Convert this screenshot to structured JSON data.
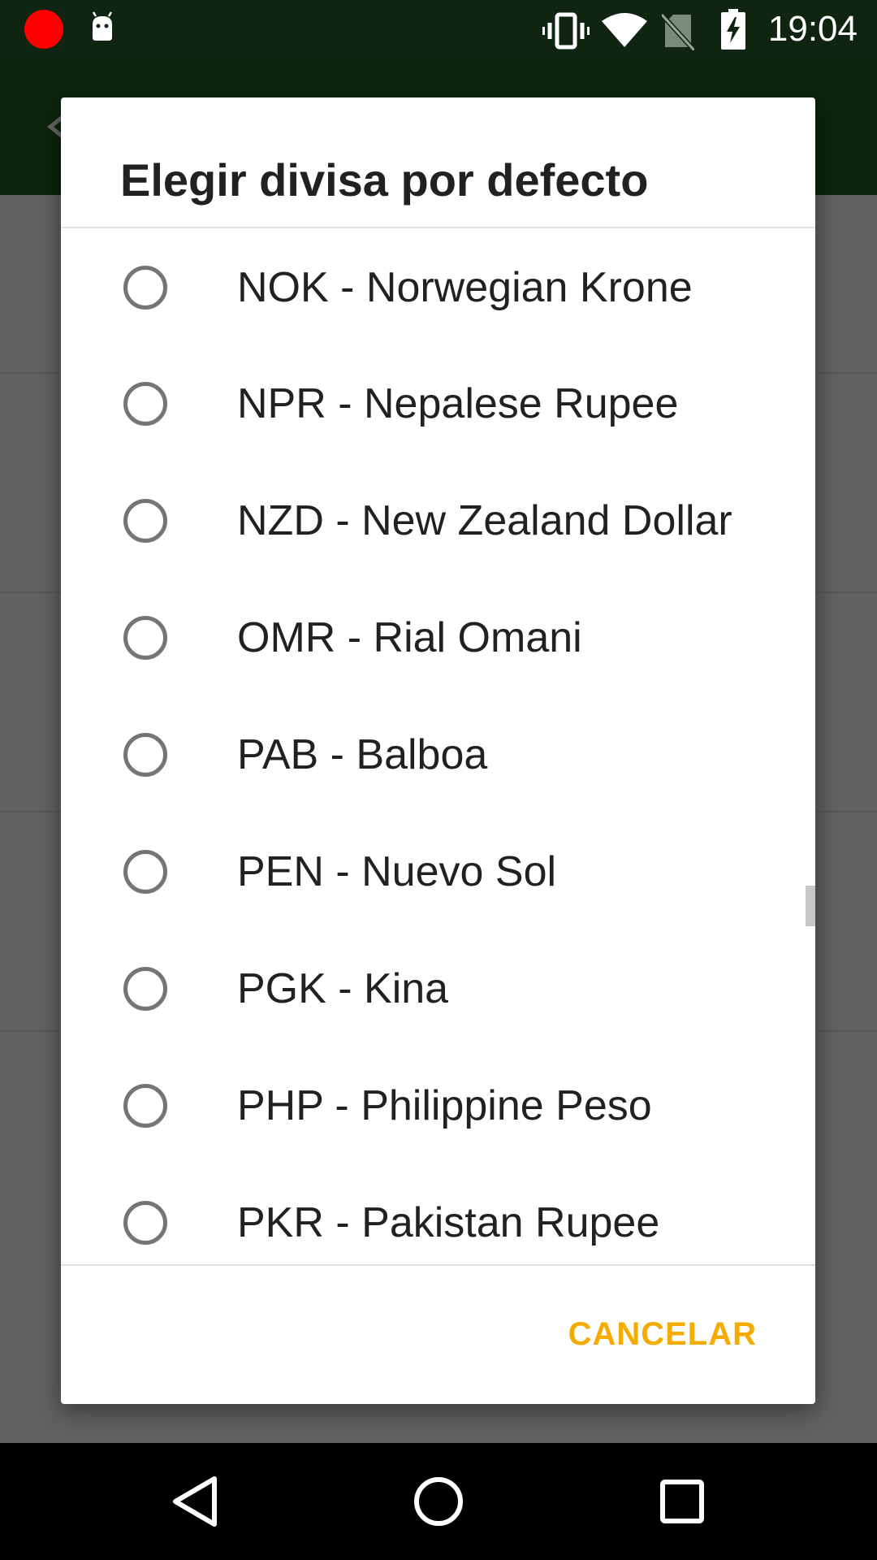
{
  "status_bar": {
    "time": "19:04",
    "icons": [
      "record-dot",
      "android-icon",
      "vibrate-icon",
      "wifi-icon",
      "no-sim-icon",
      "battery-charging-icon"
    ]
  },
  "dialog": {
    "title": "Elegir divisa por defecto",
    "items": [
      {
        "label": "NOK - Norwegian Krone",
        "selected": false
      },
      {
        "label": "NPR - Nepalese Rupee",
        "selected": false
      },
      {
        "label": "NZD - New Zealand Dollar",
        "selected": false
      },
      {
        "label": "OMR - Rial Omani",
        "selected": false
      },
      {
        "label": "PAB - Balboa",
        "selected": false
      },
      {
        "label": "PEN - Nuevo Sol",
        "selected": false
      },
      {
        "label": "PGK - Kina",
        "selected": false
      },
      {
        "label": "PHP - Philippine Peso",
        "selected": false
      },
      {
        "label": "PKR - Pakistan Rupee",
        "selected": false
      }
    ],
    "cancel_label": "CANCELAR"
  },
  "colors": {
    "accent": "#f5ab00",
    "status_bar": "#0f2411",
    "app_bar": "#1e5a20"
  },
  "nav_bar": {
    "icons": [
      "back-icon",
      "home-icon",
      "recents-icon"
    ]
  }
}
